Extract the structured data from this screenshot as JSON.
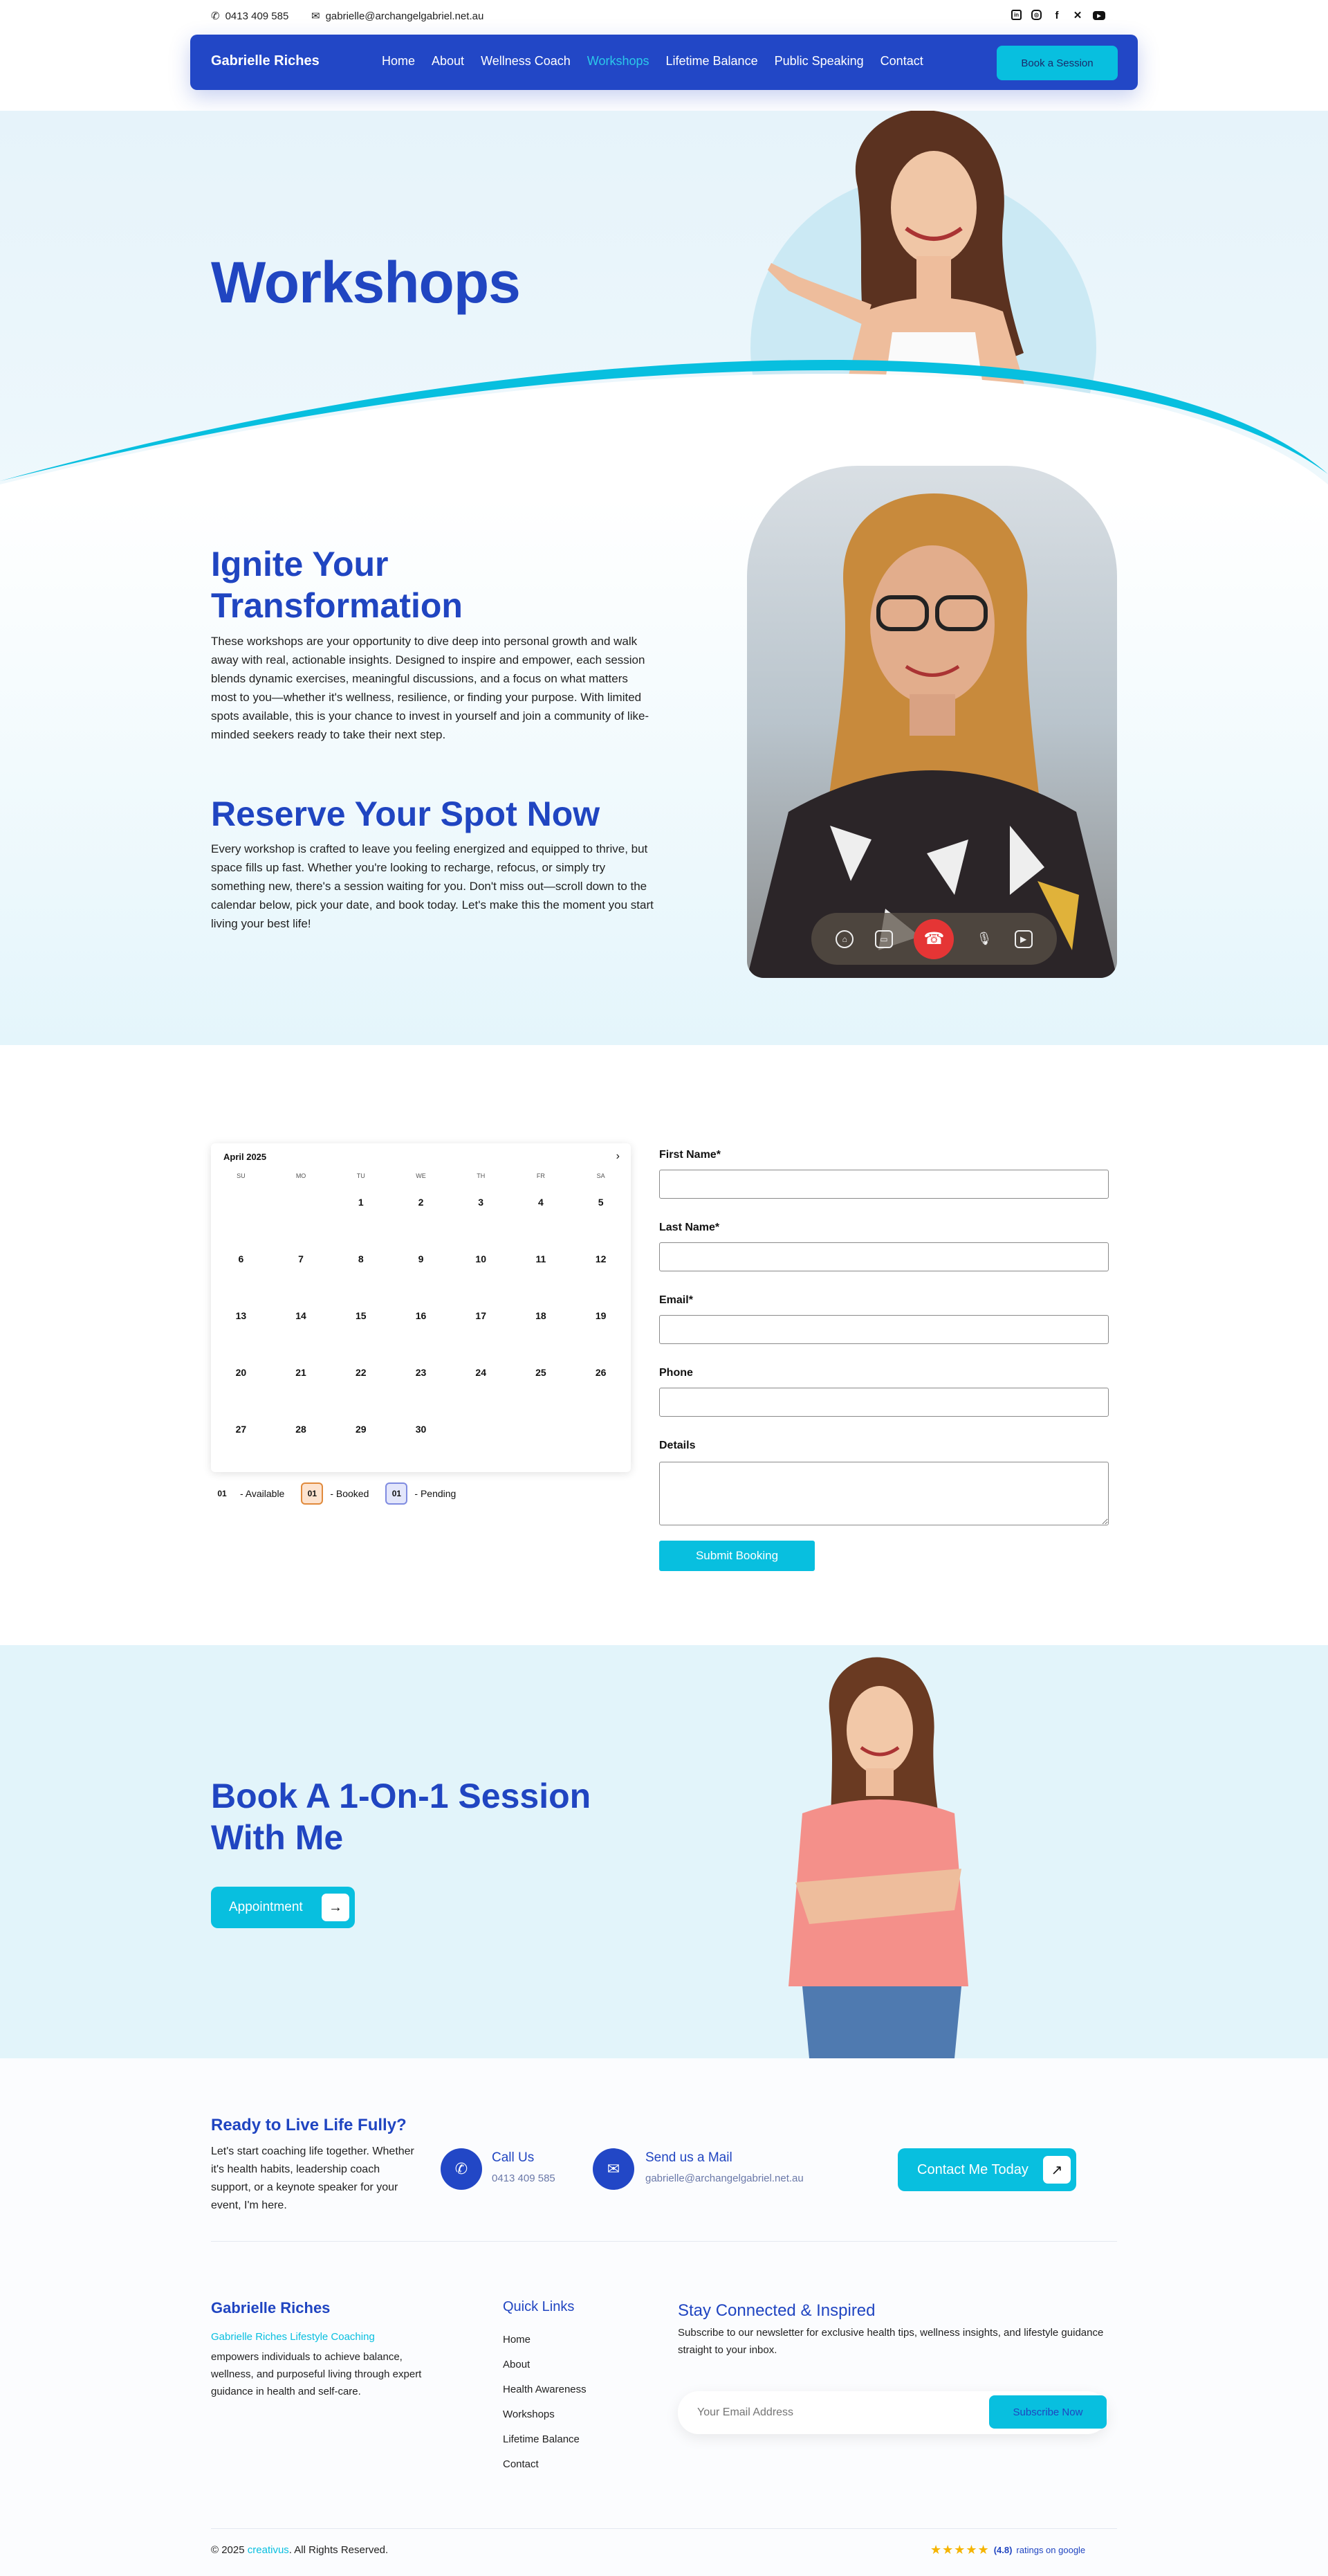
{
  "topbar": {
    "phone": "0413 409 585",
    "email": "gabrielle@archangelgabriel.net.au",
    "social": [
      "linkedin-icon",
      "instagram-icon",
      "facebook-icon",
      "x-icon",
      "youtube-icon"
    ]
  },
  "nav": {
    "brand": "Gabrielle Riches",
    "links": [
      "Home",
      "About",
      "Wellness Coach",
      "Workshops",
      "Lifetime Balance",
      "Public Speaking",
      "Contact"
    ],
    "active": "Workshops",
    "cta": "Book a Session"
  },
  "hero": {
    "title": "Workshops"
  },
  "intro": {
    "heading": "Ignite Your Transformation",
    "paragraph": "These workshops are your opportunity to dive deep into personal growth and walk away with real, actionable insights. Designed to inspire and empower, each session blends dynamic exercises, meaningful discussions, and a focus on what matters most to you—whether it's wellness, resilience, or finding your purpose. With limited spots available, this is your chance to invest in yourself and join a community of like-minded seekers ready to take their next step.",
    "heading2": "Reserve Your Spot Now",
    "paragraph2": "Every workshop is crafted to leave you feeling energized and equipped to thrive, but space fills up fast. Whether you're looking to recharge, refocus, or simply try something new, there's a session waiting for you. Don't miss out—scroll down to the calendar below, pick your date, and book today. Let's make this the moment you start living your best life!"
  },
  "calendar": {
    "month": "April 2025",
    "next": "›",
    "weekdays": [
      "SU",
      "MO",
      "TU",
      "WE",
      "TH",
      "FR",
      "SA"
    ],
    "days": [
      "",
      "",
      "1",
      "2",
      "3",
      "4",
      "5",
      "6",
      "7",
      "8",
      "9",
      "10",
      "11",
      "12",
      "13",
      "14",
      "15",
      "16",
      "17",
      "18",
      "19",
      "20",
      "21",
      "22",
      "23",
      "24",
      "25",
      "26",
      "27",
      "28",
      "29",
      "30",
      "",
      "",
      ""
    ],
    "legend": [
      {
        "num": "01",
        "label": "- Available"
      },
      {
        "num": "01",
        "label": "- Booked"
      },
      {
        "num": "01",
        "label": "- Pending"
      }
    ]
  },
  "form": {
    "first": "First Name*",
    "last": "Last Name*",
    "email": "Email*",
    "phone": "Phone",
    "details": "Details",
    "submit": "Submit Booking"
  },
  "session": {
    "heading": "Book A 1-On-1 Session With Me",
    "button": "Appointment"
  },
  "footer": {
    "ready_title": "Ready to Live Life Fully?",
    "ready_text": "Let's start coaching life together. Whether it's health habits, leadership coach support, or a keynote speaker for your event, I'm here.",
    "call_label": "Call Us",
    "call_value": "0413 409 585",
    "mail_label": "Send us a Mail",
    "mail_value": "gabrielle@archangelgabriel.net.au",
    "contact_btn": "Contact Me Today",
    "brand": "Gabrielle Riches",
    "brand_highlight": "Gabrielle Riches Lifestyle Coaching",
    "brand_text": "empowers individuals to achieve balance, wellness, and purposeful living through expert guidance in health and self-care.",
    "quick_title": "Quick Links",
    "quick_links": [
      "Home",
      "About",
      "Health Awareness",
      "Workshops",
      "Lifetime Balance",
      "Contact"
    ],
    "news_title": "Stay Connected & Inspired",
    "news_text": "Subscribe to our newsletter for exclusive health tips, wellness insights, and lifestyle guidance straight to your inbox.",
    "email_placeholder": "Your Email Address",
    "subscribe": "Subscribe Now",
    "copyright_pre": "© 2025",
    "copyright_brand": "creativus",
    "copyright_post": ". All Rights Reserved.",
    "rating": "(4.8)",
    "rating_text": "ratings on google"
  },
  "colors": {
    "primary": "#2247c6",
    "accent": "#08bfdf",
    "heading": "#2045c1"
  }
}
